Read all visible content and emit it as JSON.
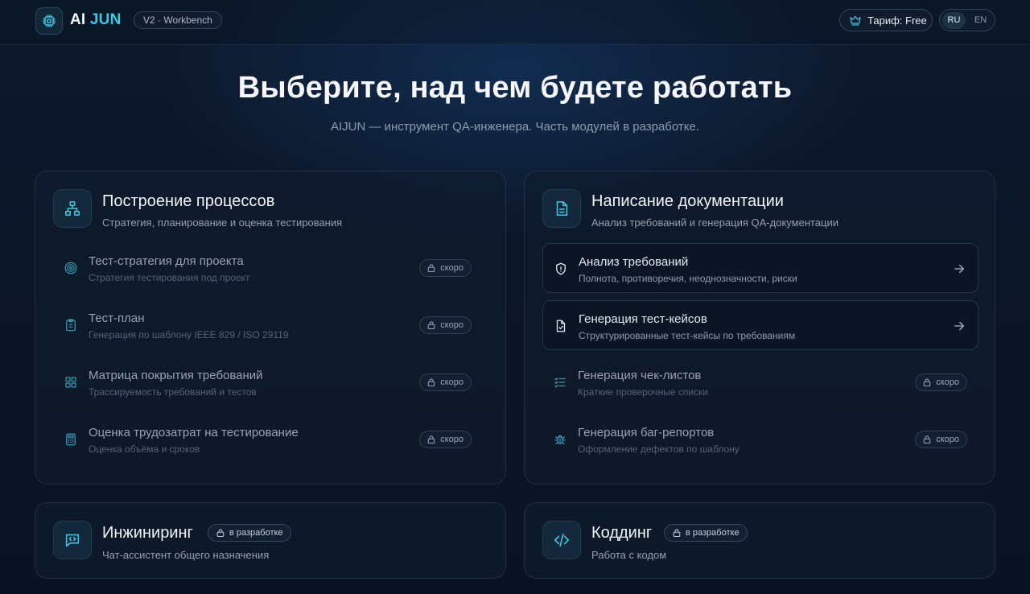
{
  "app": {
    "logo_prefix": "AI",
    "logo_accent": "JUN",
    "version": "V2 · Workbench",
    "tariff": "Тариф: Free",
    "languages": [
      "RU",
      "EN"
    ],
    "active_language": "RU"
  },
  "hero": {
    "title": "Выберите, над чем будете работать",
    "subtitle": "AIJUN — инструмент QA-инженера. Часть модулей в разработке."
  },
  "colors": {
    "accent": "#3cc8e6",
    "background": "#0b1627"
  },
  "sections": {
    "processes": {
      "title": "Построение процессов",
      "subtitle": "Стратегия, планирование и оценка тестирования",
      "icon": "sitemap-icon",
      "items": [
        {
          "title": "Тест-стратегия для проекта",
          "subtitle": "Стратегия тестирования под проект",
          "icon": "target-icon",
          "badge": "скоро"
        },
        {
          "title": "Тест-план",
          "subtitle": "Генерация по шаблону IEEE 829 / ISO 29119",
          "icon": "clipboard-icon",
          "badge": "скоро"
        },
        {
          "title": "Матрица покрытия требований",
          "subtitle": "Трассируемость требований и тестов",
          "icon": "grid-icon",
          "badge": "скоро"
        },
        {
          "title": "Оценка трудозатрат на тестирование",
          "subtitle": "Оценка объёма и сроков",
          "icon": "calculator-icon",
          "badge": "скоро"
        }
      ]
    },
    "documentation": {
      "title": "Написание документации",
      "subtitle": "Анализ требований и генерация QA-документации",
      "icon": "document-icon",
      "items": [
        {
          "title": "Анализ требований",
          "subtitle": "Полнота, противоречия, неоднозначности, риски",
          "icon": "shield-icon"
        },
        {
          "title": "Генерация тест-кейсов",
          "subtitle": "Структурированные тест-кейсы по требованиям",
          "icon": "file-check-icon"
        },
        {
          "title": "Генерация чек-листов",
          "subtitle": "Краткие проверочные списки",
          "icon": "checklist-icon",
          "badge": "скоро"
        },
        {
          "title": "Генерация баг-репортов",
          "subtitle": "Оформление дефектов по шаблону",
          "icon": "bug-icon",
          "badge": "скоро"
        }
      ]
    },
    "engineering": {
      "title": "Инжиниринг",
      "badge": "в разработке",
      "subtitle": "Чат-ассистент общего назначения",
      "icon": "chat-code-icon"
    },
    "coding": {
      "title": "Коддинг",
      "badge": "в разработке",
      "subtitle": "Работа с кодом",
      "icon": "code-icon"
    }
  }
}
